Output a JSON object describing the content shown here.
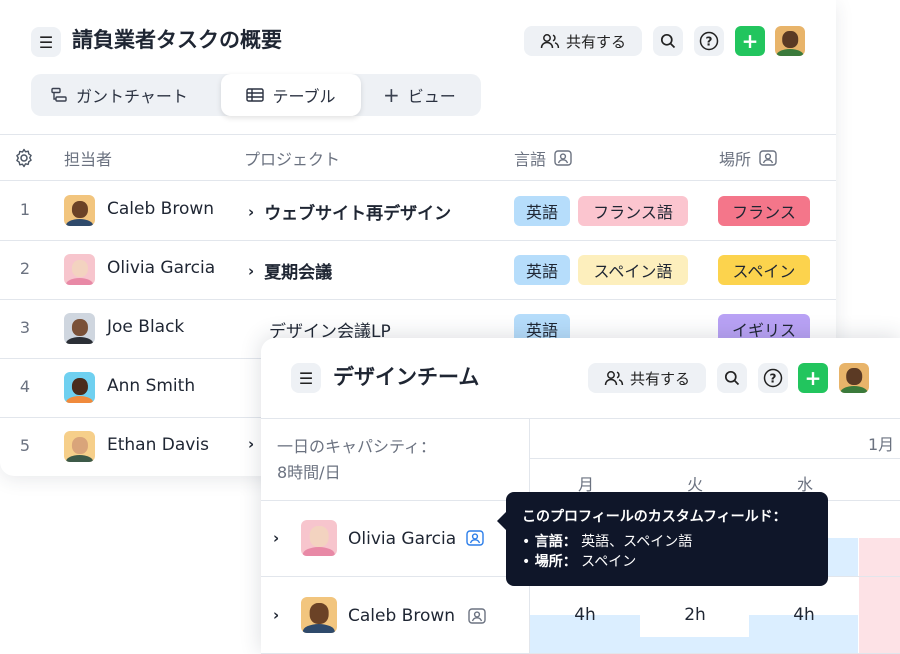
{
  "back_panel": {
    "title": "請負業者タスクの概要",
    "share_label": "共有する",
    "tabs": [
      {
        "label": "ガントチャート",
        "icon": "gantt-icon"
      },
      {
        "label": "テーブル",
        "icon": "table-icon"
      },
      {
        "label": "ビュー",
        "icon": "plus-icon"
      }
    ],
    "columns": {
      "assignee": "担当者",
      "project": "プロジェクト",
      "language": "言語",
      "location": "場所"
    },
    "rows": [
      {
        "num": "1",
        "name": "Caleb Brown",
        "project": "ウェブサイト再デザイン",
        "langs": [
          "英語",
          "フランス語"
        ],
        "place": "フランス"
      },
      {
        "num": "2",
        "name": "Olivia Garcia",
        "project": "夏期会議",
        "langs": [
          "英語",
          "スペイン語"
        ],
        "place": "スペイン"
      },
      {
        "num": "3",
        "name": "Joe Black",
        "project": "デザイン会議LP",
        "langs": [
          "英語"
        ],
        "place": "イギリス"
      },
      {
        "num": "4",
        "name": "Ann Smith"
      },
      {
        "num": "5",
        "name": "Ethan Davis"
      }
    ]
  },
  "front_panel": {
    "title": "デザインチーム",
    "share_label": "共有する",
    "capacity_label": "一日のキャパシティ：",
    "capacity_value": "8時間/日",
    "month": "1月",
    "days": [
      "月",
      "火",
      "水"
    ],
    "rows": [
      {
        "name": "Olivia Garcia"
      },
      {
        "name": "Caleb Brown",
        "hours": [
          "4h",
          "2h",
          "4h"
        ]
      }
    ]
  },
  "tooltip": {
    "title": "このプロフィールのカスタムフィールド：",
    "items": [
      {
        "key": "言語：",
        "value": "英語、スペイン語"
      },
      {
        "key": "場所：",
        "value": "スペイン"
      }
    ]
  },
  "colors": {
    "tag_blue": "#b6ddfb",
    "tag_pink": "#fbc5cf",
    "tag_yellow": "#fdefbd",
    "place_red": "#f4768a",
    "place_yellow": "#fcd34d",
    "place_purple": "#b9a2f5",
    "plus_green": "#22c55e",
    "tooltip_bg": "#0f1629"
  }
}
